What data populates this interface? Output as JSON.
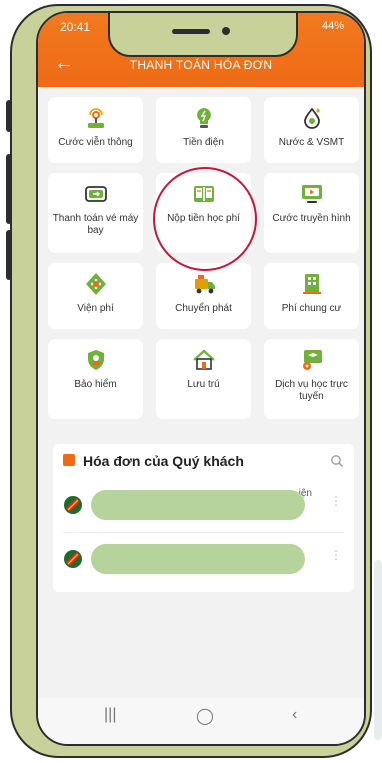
{
  "status_bar": {
    "time": "20:41",
    "right": "44%"
  },
  "header": {
    "title": "THANH TOÁN HÓA ĐƠN",
    "back_icon": "arrow-left-icon"
  },
  "services": [
    {
      "label": "Cước viễn thông",
      "icon": "antenna-icon"
    },
    {
      "label": "Tiền điện",
      "icon": "lightbulb-icon"
    },
    {
      "label": "Nước & VSMT",
      "icon": "water-drop-icon"
    },
    {
      "label": "Thanh toán vé máy bay",
      "icon": "plane-ticket-icon"
    },
    {
      "label": "Nộp tiền học phí",
      "icon": "open-book-icon"
    },
    {
      "label": "Cước truyền hình",
      "icon": "tv-play-icon"
    },
    {
      "label": "Viện phí",
      "icon": "medical-cross-icon"
    },
    {
      "label": "Chuyển phát",
      "icon": "delivery-truck-icon"
    },
    {
      "label": "Phí chung cư",
      "icon": "building-icon"
    },
    {
      "label": "Bảo hiểm",
      "icon": "shield-icon"
    },
    {
      "label": "Lưu trú",
      "icon": "house-icon"
    },
    {
      "label": "Dịch vụ học trực tuyến",
      "icon": "online-learning-icon"
    }
  ],
  "bills": {
    "title": "Hóa đơn của Quý khách",
    "rows": [
      {
        "snippet": "iện",
        "logo": "provider-logo-icon"
      },
      {
        "snippet": "",
        "logo": "provider-logo-icon"
      }
    ]
  },
  "colors": {
    "accent": "#ef6a15",
    "highlight_circle": "#c2183a",
    "redaction": "#b6d39c"
  },
  "nav": {
    "recent": "|||",
    "home": "◯",
    "back": "‹"
  }
}
